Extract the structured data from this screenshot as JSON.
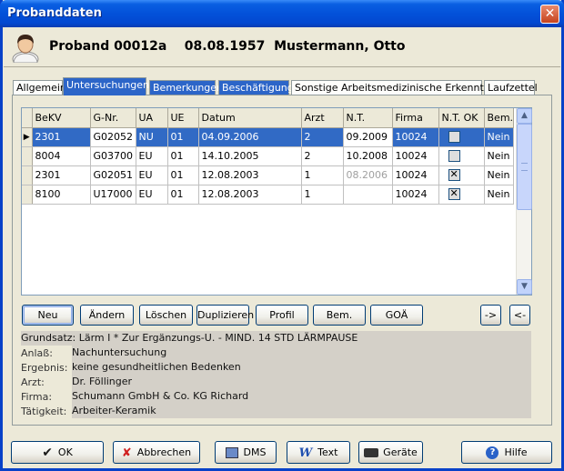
{
  "window": {
    "title": "Probanddaten",
    "close_glyph": "✕"
  },
  "header": {
    "title": "Proband 00012a    08.08.1957  Mustermann, Otto"
  },
  "tabs": [
    {
      "label": "Allgemein"
    },
    {
      "label": "Untersuchungen"
    },
    {
      "label": "Bemerkungen"
    },
    {
      "label": "Beschäftigung"
    },
    {
      "label": "Sonstige Arbeitsmedizinische Erkenntnisse"
    },
    {
      "label": "Laufzettel"
    }
  ],
  "grid": {
    "columns": [
      "BeKV",
      "G-Nr.",
      "UA",
      "UE",
      "Datum",
      "Arzt",
      "N.T.",
      "Firma",
      "N.T. OK",
      "Bem."
    ],
    "rows": [
      {
        "bekv": "2301",
        "gnr": "G02052",
        "ua": "NU",
        "ue": "01",
        "datum": "04.09.2006",
        "arzt": "2",
        "nt": "09.2009",
        "firma": "10024",
        "ntok": false,
        "bem": "Nein",
        "selected": true
      },
      {
        "bekv": "8004",
        "gnr": "G03700",
        "ua": "EU",
        "ue": "01",
        "datum": "14.10.2005",
        "arzt": "2",
        "nt": "10.2008",
        "firma": "10024",
        "ntok": false,
        "bem": "Nein",
        "selected": false
      },
      {
        "bekv": "2301",
        "gnr": "G02051",
        "ua": "EU",
        "ue": "01",
        "datum": "12.08.2003",
        "arzt": "1",
        "nt": "08.2006",
        "firma": "10024",
        "ntok": true,
        "bem": "Nein",
        "selected": false
      },
      {
        "bekv": "8100",
        "gnr": "U17000",
        "ua": "EU",
        "ue": "01",
        "datum": "12.08.2003",
        "arzt": "1",
        "nt": "",
        "firma": "10024",
        "ntok": true,
        "bem": "Nein",
        "selected": false
      }
    ]
  },
  "actions": {
    "neu": "Neu",
    "aendern": "Ändern",
    "loeschen": "Löschen",
    "duplizieren": "Duplizieren",
    "profil": "Profil",
    "bem": "Bem.",
    "goa": "GOÄ",
    "next": "->",
    "prev": "<-"
  },
  "details": {
    "grundsatz": "Grundsatz:  Lärm I * Zur Ergänzungs-U. - MIND. 14 STD LÄRMPAUSE",
    "anlass_label": "Anlaß:",
    "anlass": "Nachuntersuchung",
    "ergebnis_label": "Ergebnis:",
    "ergebnis": "keine gesundheitlichen Bedenken",
    "arzt_label": "Arzt:",
    "arzt": "Dr. Föllinger",
    "firma_label": "Firma:",
    "firma": "Schumann GmbH & Co. KG Richard",
    "taetigkeit_label": "Tätigkeit:",
    "taetigkeit": "Arbeiter-Keramik"
  },
  "footer": {
    "ok": "OK",
    "abbrechen": "Abbrechen",
    "dms": "DMS",
    "text": "Text",
    "geraete": "Geräte",
    "hilfe": "Hilfe"
  },
  "colors": {
    "selection": "#316AC5",
    "titlebar": "#0351D9",
    "tab_blue": "#2C65C8"
  }
}
